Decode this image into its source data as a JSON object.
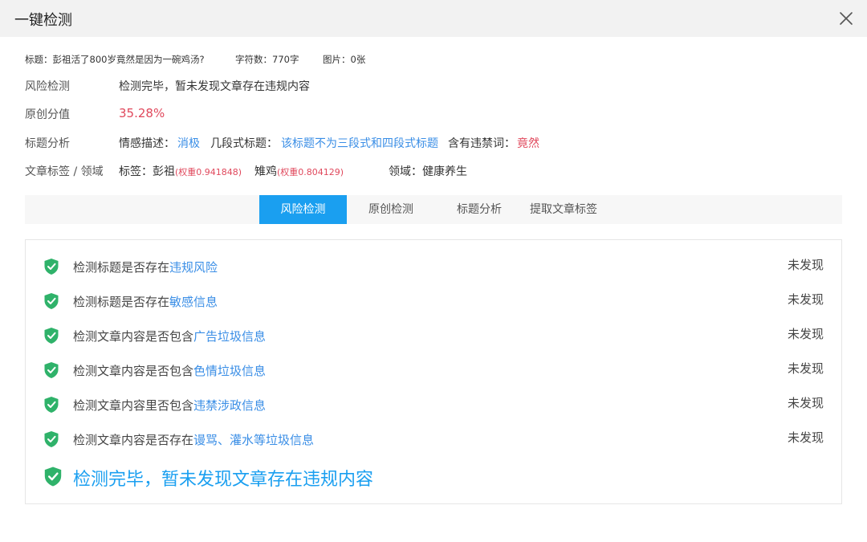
{
  "header": {
    "title": "一键检测"
  },
  "meta": {
    "title_label": "标题：彭祖活了800岁竟然是因为一碗鸡汤?",
    "char_count": "字符数：770字",
    "images": "图片：0张"
  },
  "info": {
    "risk": {
      "label": "风险检测",
      "value": "检测完毕，暂未发现文章存在违规内容"
    },
    "originality": {
      "label": "原创分值",
      "value": "35.28%"
    },
    "title_analysis": {
      "label": "标题分析",
      "sentiment_label": "情感描述：",
      "sentiment_value": "消极",
      "segment_label": "几段式标题：",
      "segment_value": "该标题不为三段式和四段式标题",
      "banned_label": "含有违禁词：",
      "banned_value": "竟然"
    },
    "tags": {
      "label": "文章标签 / 领域",
      "tag_label": "标签：彭祖",
      "tag1_weight": "(权重0.941848)",
      "tag2_name": "雉鸡",
      "tag2_weight": "(权重0.804129)",
      "domain_label": "领域：健康养生"
    }
  },
  "tabs": [
    {
      "label": "风险检测",
      "active": true
    },
    {
      "label": "原创检测",
      "active": false
    },
    {
      "label": "标题分析",
      "active": false
    },
    {
      "label": "提取文章标签",
      "active": false
    }
  ],
  "checks": [
    {
      "prefix": "检测标题是否存在",
      "highlight": "违规风险",
      "status": "未发现"
    },
    {
      "prefix": "检测标题是否存在",
      "highlight": "敏感信息",
      "status": "未发现"
    },
    {
      "prefix": "检测文章内容是否包含",
      "highlight": "广告垃圾信息",
      "status": "未发现"
    },
    {
      "prefix": "检测文章内容是否包含",
      "highlight": "色情垃圾信息",
      "status": "未发现"
    },
    {
      "prefix": "检测文章内容里否包含",
      "highlight": "违禁涉政信息",
      "status": "未发现"
    },
    {
      "prefix": "检测文章内容是否存在",
      "highlight": "谩骂、灌水等垃圾信息",
      "status": "未发现"
    }
  ],
  "summary": "检测完毕，暂未发现文章存在违规内容",
  "colors": {
    "accent": "#1a9ff0",
    "link": "#3a8ee6",
    "danger": "#e0485c",
    "shield": "#2fb26a"
  },
  "icons": {
    "close": "close-icon",
    "shield": "shield-check-icon"
  }
}
